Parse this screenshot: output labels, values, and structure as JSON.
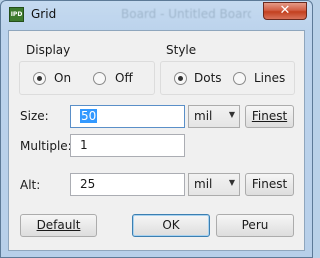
{
  "window": {
    "title": "Grid",
    "background_title": "Board - Untitled Board",
    "app_icon": "app-icon",
    "close_symbol": "✕"
  },
  "display": {
    "label": "Display",
    "options": [
      {
        "label": "On",
        "checked": true
      },
      {
        "label": "Off",
        "checked": false
      }
    ]
  },
  "style": {
    "label": "Style",
    "options": [
      {
        "label": "Dots",
        "checked": true
      },
      {
        "label": "Lines",
        "checked": false
      }
    ]
  },
  "size": {
    "label": "Size:",
    "value": "50",
    "unit": "mil",
    "finest_button": "Finest"
  },
  "multiple": {
    "label": "Multiple:",
    "value": "1"
  },
  "alt": {
    "label": "Alt:",
    "value": "25",
    "unit": "mil",
    "finest_button": "Finest"
  },
  "buttons": {
    "default": "Default",
    "ok": "OK",
    "peru": "Peru"
  },
  "colors": {
    "selection": "#3399ff",
    "close_button": "#c3401f",
    "frame": "#b9d1e8"
  }
}
